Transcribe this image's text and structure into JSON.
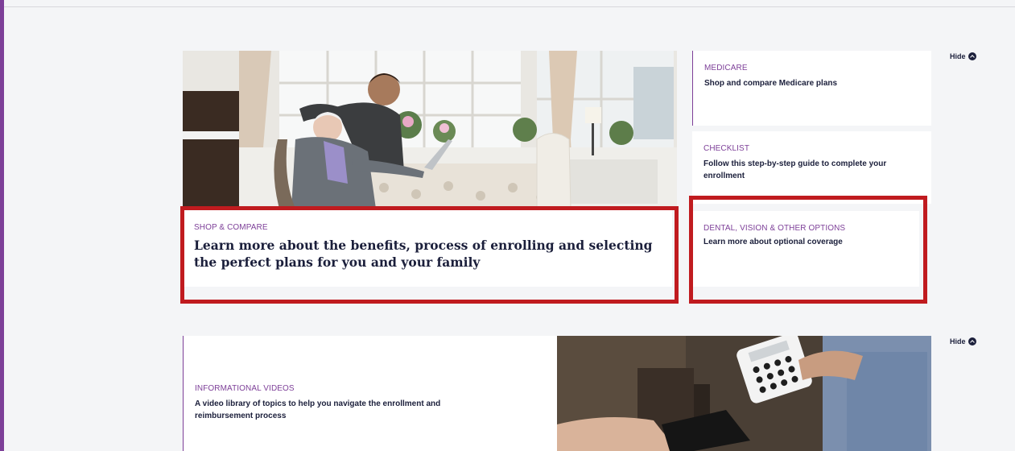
{
  "colors": {
    "accent": "#7d3f98",
    "navy": "#1b1f3b",
    "highlight": "#c01b1f",
    "background": "#f4f5f7"
  },
  "section1": {
    "hide_label": "Hide",
    "hero": {
      "eyebrow": "SHOP & COMPARE",
      "heading": "Learn more about the benefits, process of enrolling and selecting the perfect plans for you and your family"
    },
    "cards": [
      {
        "eyebrow": "MEDICARE",
        "title": "Shop and compare Medicare plans"
      },
      {
        "eyebrow": "CHECKLIST",
        "title": "Follow this step-by-step guide to complete your enrollment"
      },
      {
        "eyebrow": "DENTAL, VISION & OTHER OPTIONS",
        "title": "Learn more about optional coverage"
      }
    ]
  },
  "section2": {
    "hide_label": "Hide",
    "video": {
      "eyebrow": "INFORMATIONAL VIDEOS",
      "title": "A video library of topics to help you navigate the enrollment and reimbursement process"
    }
  }
}
